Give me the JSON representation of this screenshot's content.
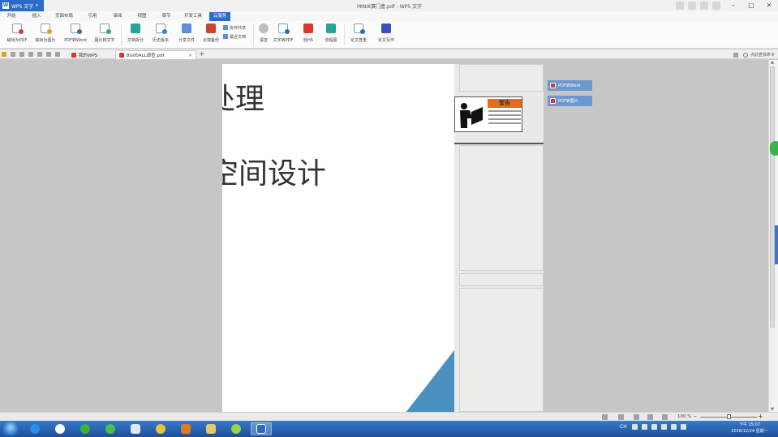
{
  "app": {
    "name": "WPS 文字",
    "window_title": "MINIK赛门盒.pdf - WPS 文字"
  },
  "menu": {
    "tabs": [
      "开始",
      "插入",
      "页面布局",
      "引用",
      "审阅",
      "视图",
      "章节",
      "开发工具",
      "云服务"
    ],
    "active_index": 8
  },
  "ribbon": {
    "buttons": [
      {
        "label": "输出为PDF",
        "accent": "#d9382f"
      },
      {
        "label": "输出为图片",
        "accent": "#e0a020"
      },
      {
        "label": "PDF转Word",
        "accent": "#2b6bc6"
      },
      {
        "label": "图片转文字",
        "accent": "#3aa657"
      },
      {
        "label": "文档拆分",
        "accent": "#23a59b"
      },
      {
        "label": "历史版本",
        "accent": "#3b82d6"
      },
      {
        "label": "分享文件",
        "accent": "#5b8fd6"
      },
      {
        "label": "云端备份",
        "accent": "#c8442f"
      },
      {
        "label": "语音",
        "accent": "#888888"
      },
      {
        "label": "文字转PDF",
        "accent": "#2b6bc6"
      },
      {
        "label": "轻H5",
        "accent": "#d9382f"
      },
      {
        "label": "流程图",
        "accent": "#23a59b"
      },
      {
        "label": "论文查重",
        "accent": "#2b6bc6"
      },
      {
        "label": "论文写作",
        "accent": "#3b4fb8"
      }
    ],
    "small_items": [
      "协作共享",
      "最近文档"
    ]
  },
  "doc_tabs": [
    {
      "label": "我的WPS",
      "active": false
    },
    {
      "label": "8G00ALL调查.pdf",
      "active": true
    }
  ],
  "search_hint": "点此查找命令",
  "document": {
    "heading_1": "处理",
    "heading_2": "空间设计",
    "warning_title": "警告"
  },
  "side_panel": {
    "buttons": [
      "PDF转Word",
      "PDF转图片"
    ]
  },
  "status": {
    "zoom": "100 %"
  },
  "taskbar": {
    "language": "CH",
    "time": "下午 15:07",
    "date": "2018/12/24 星期一"
  },
  "colors": {
    "accent": "#2b6bc6",
    "slide_blue": "#4a90c0",
    "warning_orange": "#e46c1b"
  }
}
